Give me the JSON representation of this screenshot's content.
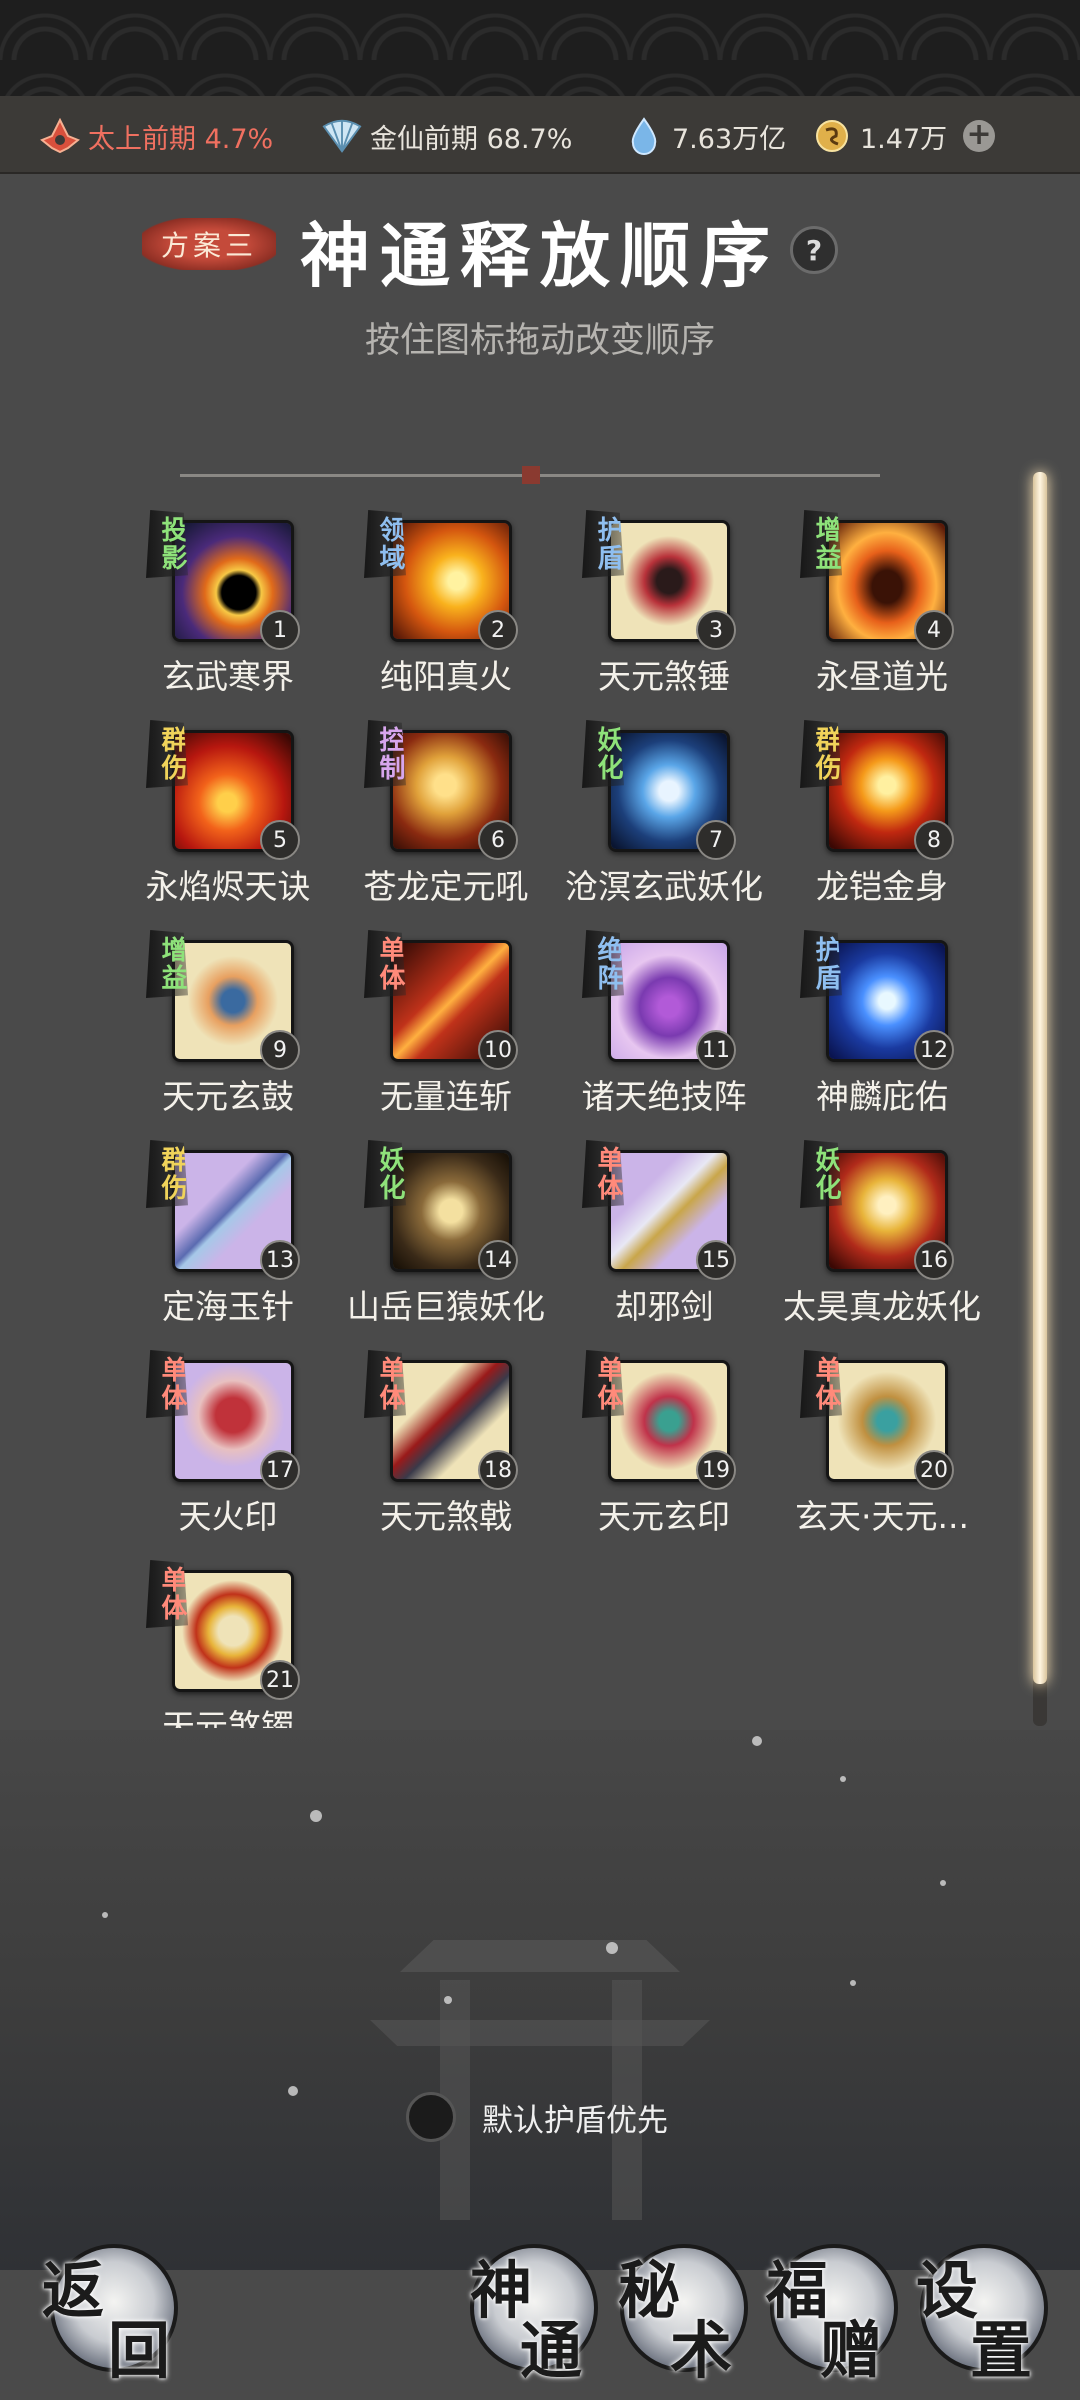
{
  "status": {
    "cultivation": "太上前期 4.7%",
    "realm": "金仙前期 68.7%",
    "spirit_stones": "7.63万亿",
    "currency": "1.47万"
  },
  "header": {
    "plan_tag": "方案三",
    "title": "神通释放顺序",
    "help": "?",
    "subtitle": "按住图标拖动改变顺序"
  },
  "skills": [
    {
      "tag": "投影",
      "num": "1",
      "name": "玄武寒界"
    },
    {
      "tag": "领域",
      "num": "2",
      "name": "纯阳真火"
    },
    {
      "tag": "护盾",
      "num": "3",
      "name": "天元煞锤"
    },
    {
      "tag": "增益",
      "num": "4",
      "name": "永昼道光"
    },
    {
      "tag": "群伤",
      "num": "5",
      "name": "永焰烬天诀"
    },
    {
      "tag": "控制",
      "num": "6",
      "name": "苍龙定元吼"
    },
    {
      "tag": "妖化",
      "num": "7",
      "name": "沧溟玄武妖化"
    },
    {
      "tag": "群伤",
      "num": "8",
      "name": "龙铠金身"
    },
    {
      "tag": "增益",
      "num": "9",
      "name": "天元玄鼓"
    },
    {
      "tag": "单体",
      "num": "10",
      "name": "无量连斩"
    },
    {
      "tag": "绝阵",
      "num": "11",
      "name": "诸天绝技阵"
    },
    {
      "tag": "护盾",
      "num": "12",
      "name": "神麟庇佑"
    },
    {
      "tag": "群伤",
      "num": "13",
      "name": "定海玉针"
    },
    {
      "tag": "妖化",
      "num": "14",
      "name": "山岳巨猿妖化"
    },
    {
      "tag": "单体",
      "num": "15",
      "name": "却邪剑"
    },
    {
      "tag": "妖化",
      "num": "16",
      "name": "太昊真龙妖化"
    },
    {
      "tag": "单体",
      "num": "17",
      "name": "天火印"
    },
    {
      "tag": "单体",
      "num": "18",
      "name": "天元煞戟"
    },
    {
      "tag": "单体",
      "num": "19",
      "name": "天元玄印"
    },
    {
      "tag": "单体",
      "num": "20",
      "name": "玄天·天元..."
    },
    {
      "tag": "单体",
      "num": "21",
      "name": "天元煞镯"
    }
  ],
  "default_shield_label": "默认护盾优先",
  "nav": {
    "back": [
      "返",
      "回"
    ],
    "skills": [
      "神",
      "通"
    ],
    "secret": [
      "秘",
      "术"
    ],
    "gift": [
      "福",
      "赠"
    ],
    "settings": [
      "设",
      "置"
    ]
  },
  "colors": {
    "cultivation_text": "#f07060",
    "accent_scroll": "#fff5e0",
    "tag_red": "#ff8a7a",
    "tag_green": "#8ee27a",
    "tag_blue": "#8fbff0",
    "tag_purple": "#d7a6ee",
    "tag_yellow": "#f0d35a"
  }
}
